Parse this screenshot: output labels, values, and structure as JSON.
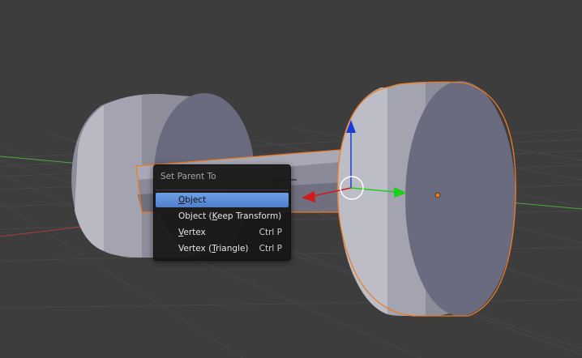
{
  "menu": {
    "title": "Set Parent To",
    "items": [
      {
        "label_pre": "",
        "label_ul": "O",
        "label_post": "bject",
        "shortcut": "",
        "active": true
      },
      {
        "label_pre": "Object (",
        "label_ul": "K",
        "label_post": "eep Transform)",
        "shortcut": "",
        "active": false
      },
      {
        "label_pre": "",
        "label_ul": "V",
        "label_post": "ertex",
        "shortcut": "Ctrl P",
        "active": false
      },
      {
        "label_pre": "Vertex (",
        "label_ul": "T",
        "label_post": "riangle)",
        "shortcut": "Ctrl P",
        "active": false
      }
    ]
  },
  "scene": {
    "background_color": "#3d3d3d",
    "grid_color": "#474747",
    "x_axis_color": "#b33a3a",
    "y_axis_color": "#4ea83b",
    "selection_outline_color": "#f07b1f",
    "active_item_color": "#5b8fd9",
    "manipulator_z_color": "#1a3bd1",
    "manipulator_x_color": "#d11a1a",
    "manipulator_y_color": "#1ad11a"
  }
}
